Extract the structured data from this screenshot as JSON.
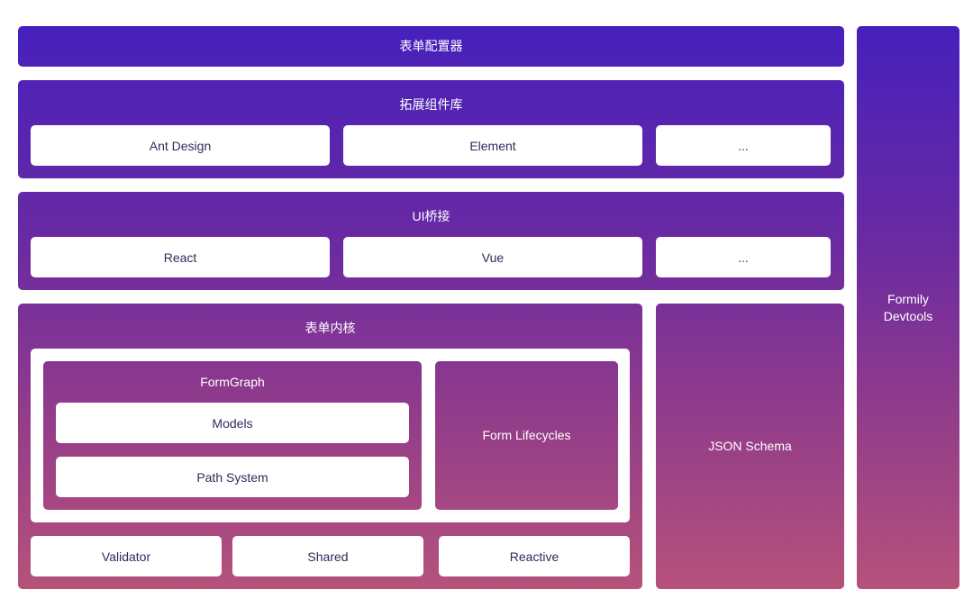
{
  "configurator": {
    "title": "表单配置器"
  },
  "extensions": {
    "title": "拓展组件库",
    "items": [
      "Ant Design",
      "Element",
      "..."
    ]
  },
  "bridge": {
    "title": "UI桥接",
    "items": [
      "React",
      "Vue",
      "..."
    ]
  },
  "core": {
    "title": "表单内核",
    "formgraph": {
      "title": "FormGraph",
      "items": [
        "Models",
        "Path System"
      ]
    },
    "lifecycles": "Form Lifecycles",
    "bottom": [
      "Validator",
      "Shared",
      "Reactive"
    ]
  },
  "schema": {
    "title": "JSON Schema"
  },
  "devtools": {
    "line1": "Formily",
    "line2": "Devtools"
  },
  "colors": {
    "top": "#4620BC",
    "bottom": "#B6527A",
    "text_dark": "#2E2C5C"
  }
}
